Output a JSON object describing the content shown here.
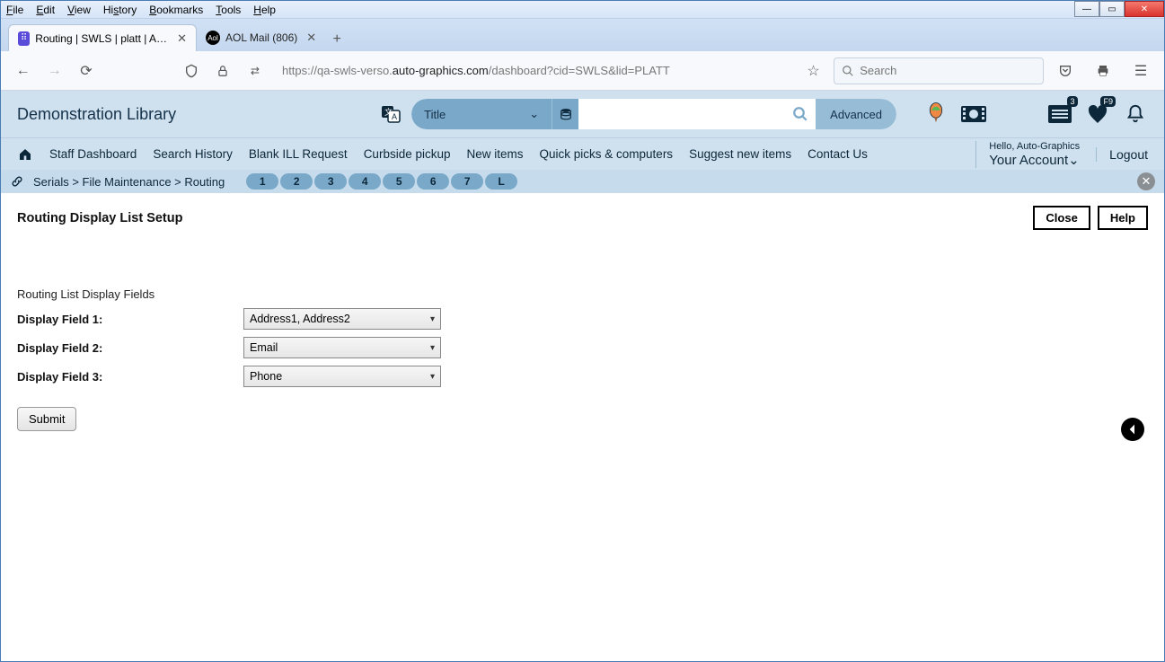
{
  "browser": {
    "menus": [
      "File",
      "Edit",
      "View",
      "History",
      "Bookmarks",
      "Tools",
      "Help"
    ],
    "tabs": [
      {
        "title": "Routing | SWLS | platt | Auto-Gr...",
        "active": true
      },
      {
        "title": "AOL Mail (806)",
        "active": false
      }
    ],
    "url_prefix": "https://qa-swls-verso.",
    "url_domain": "auto-graphics.com",
    "url_suffix": "/dashboard?cid=SWLS&lid=PLATT",
    "search_placeholder": "Search"
  },
  "header": {
    "library_name": "Demonstration Library",
    "search_type": "Title",
    "advanced_label": "Advanced",
    "list_badge": "3",
    "fav_badge": "F9"
  },
  "nav": {
    "items": [
      "Staff Dashboard",
      "Search History",
      "Blank ILL Request",
      "Curbside pickup",
      "New items",
      "Quick picks & computers",
      "Suggest new items",
      "Contact Us"
    ],
    "greeting": "Hello, Auto-Graphics",
    "account_label": "Your Account",
    "logout": "Logout"
  },
  "crumbs": {
    "path": "Serials > File Maintenance > Routing",
    "pills": [
      "1",
      "2",
      "3",
      "4",
      "5",
      "6",
      "7",
      "L"
    ]
  },
  "page": {
    "title": "Routing Display List Setup",
    "close": "Close",
    "help": "Help",
    "section_label": "Routing List Display Fields",
    "fields": [
      {
        "label": "Display Field 1:",
        "value": "Address1, Address2"
      },
      {
        "label": "Display Field 2:",
        "value": "Email"
      },
      {
        "label": "Display Field 3:",
        "value": "Phone"
      }
    ],
    "submit": "Submit"
  }
}
